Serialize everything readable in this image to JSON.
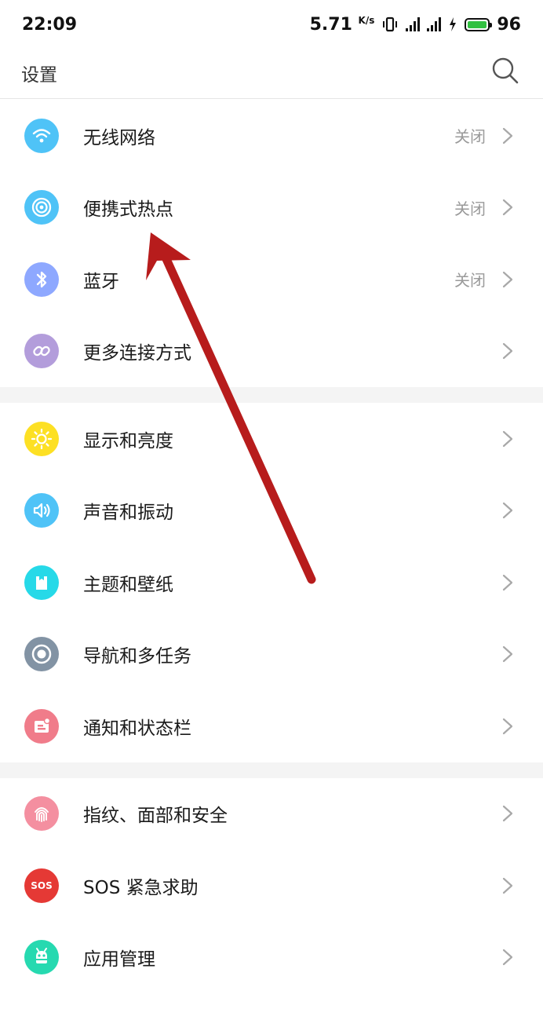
{
  "status_bar": {
    "time": "22:09",
    "net_speed": "5.71",
    "net_unit": "K/s",
    "battery_level": "96",
    "battery_color": "#31c040"
  },
  "header": {
    "title": "设置",
    "search_icon": "search-icon"
  },
  "groups": [
    [
      {
        "label": "无线网络",
        "value": "关闭",
        "icon": "wifi-icon",
        "color": "#4fc3f7"
      },
      {
        "label": "便携式热点",
        "value": "关闭",
        "icon": "hotspot-icon",
        "color": "#4fc3f7"
      },
      {
        "label": "蓝牙",
        "value": "关闭",
        "icon": "bluetooth-icon",
        "color": "#8ea8ff"
      },
      {
        "label": "更多连接方式",
        "value": "",
        "icon": "link-icon",
        "color": "#b39ddb"
      }
    ],
    [
      {
        "label": "显示和亮度",
        "value": "",
        "icon": "brightness-icon",
        "color": "#fde024"
      },
      {
        "label": "声音和振动",
        "value": "",
        "icon": "sound-icon",
        "color": "#4fc3f7"
      },
      {
        "label": "主题和壁纸",
        "value": "",
        "icon": "theme-icon",
        "color": "#26d9e8"
      },
      {
        "label": "导航和多任务",
        "value": "",
        "icon": "navigation-icon",
        "color": "#8293a4"
      },
      {
        "label": "通知和状态栏",
        "value": "",
        "icon": "notification-icon",
        "color": "#f07c8a"
      }
    ],
    [
      {
        "label": "指纹、面部和安全",
        "value": "",
        "icon": "fingerprint-icon",
        "color": "#f48fa0"
      },
      {
        "label": "SOS 紧急求助",
        "value": "",
        "icon": "sos-icon",
        "color": "#e53935",
        "badge": "SOS"
      },
      {
        "label": "应用管理",
        "value": "",
        "icon": "app-manage-icon",
        "color": "#26d9b0"
      }
    ]
  ],
  "annotation_arrow_color": "#b71c1c"
}
